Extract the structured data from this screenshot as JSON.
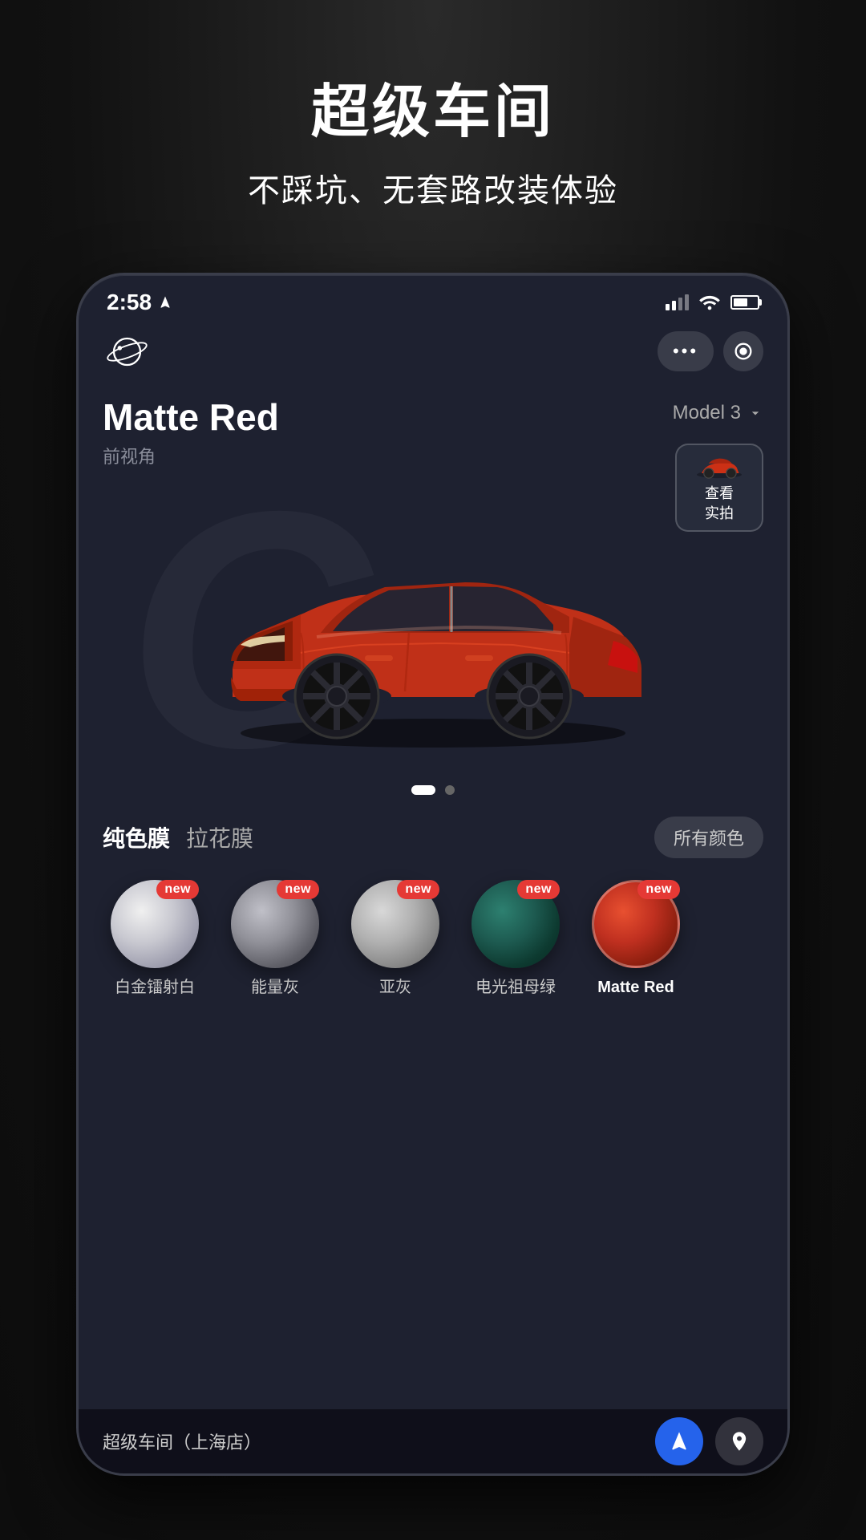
{
  "page": {
    "background": "#1a1a1a"
  },
  "top": {
    "main_title": "超级车间",
    "sub_title": "不踩坑、无套路改装体验"
  },
  "phone": {
    "status_bar": {
      "time": "2:58",
      "location_arrow": "◁"
    },
    "header": {
      "more_dots": "•••"
    },
    "car_info": {
      "name": "Matte Red",
      "angle": "前视角",
      "model": "Model 3",
      "photo_preview_line1": "查看",
      "photo_preview_line2": "实拍"
    },
    "pagination": {
      "active_index": 0,
      "total": 2
    },
    "tabs": {
      "items": [
        {
          "id": "solid",
          "label": "纯色膜",
          "active": true
        },
        {
          "id": "brushed",
          "label": "拉花膜",
          "active": false
        }
      ],
      "all_colors_label": "所有颜色"
    },
    "colors": [
      {
        "id": "white-gold",
        "label": "白金镭射白",
        "is_new": true,
        "active": false,
        "swatch_class": "white-gold"
      },
      {
        "id": "energy-gray",
        "label": "能量灰",
        "is_new": true,
        "active": false,
        "swatch_class": "energy-gray"
      },
      {
        "id": "sub-gray",
        "label": "亚灰",
        "is_new": true,
        "active": false,
        "swatch_class": "sub-gray"
      },
      {
        "id": "teal-green",
        "label": "电光祖母绿",
        "is_new": true,
        "active": false,
        "swatch_class": "teal-green"
      },
      {
        "id": "matte-red",
        "label": "Matte Red",
        "is_new": true,
        "active": true,
        "swatch_class": "matte-red"
      }
    ],
    "bottom_bar": {
      "location": "超级车间（上海店）"
    }
  }
}
